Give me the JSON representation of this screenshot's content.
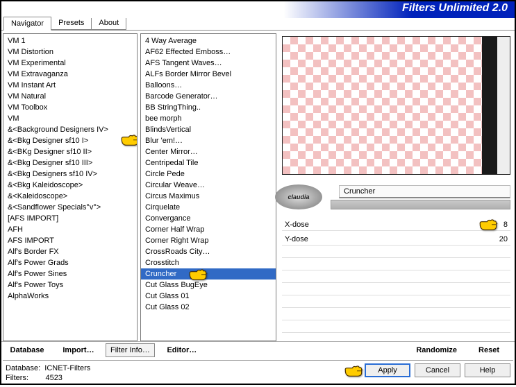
{
  "header": {
    "title": "Filters Unlimited 2.0"
  },
  "tabs": [
    {
      "label": "Navigator",
      "active": true
    },
    {
      "label": "Presets",
      "active": false
    },
    {
      "label": "About",
      "active": false
    }
  ],
  "categories": [
    "VM 1",
    "VM Distortion",
    "VM Experimental",
    "VM Extravaganza",
    "VM Instant Art",
    "VM Natural",
    "VM Toolbox",
    "VM",
    "&<Background Designers IV>",
    "&<Bkg Designer sf10 I>",
    "&<BKg Designer sf10 II>",
    "&<Bkg Designer sf10 III>",
    "&<Bkg Designers sf10 IV>",
    "&<Bkg Kaleidoscope>",
    "&<Kaleidoscope>",
    "&<Sandflower Specials°v°>",
    "[AFS IMPORT]",
    "AFH",
    "AFS IMPORT",
    "Alf's Border FX",
    "Alf's Power Grads",
    "Alf's Power Sines",
    "Alf's Power Toys",
    "AlphaWorks"
  ],
  "categories_pointer_index": 9,
  "filters": [
    "4 Way Average",
    "AF62 Effected Emboss…",
    "AFS Tangent Waves…",
    "ALFs Border Mirror Bevel",
    "Balloons…",
    "Barcode Generator…",
    "BB StringThing..",
    "bee morph",
    "BlindsVertical",
    "Blur 'em!…",
    "Center Mirror…",
    "Centripedal Tile",
    "Circle Pede",
    "Circular Weave…",
    "Circus Maximus",
    "Cirquelate",
    "Convergance",
    "Corner Half Wrap",
    "Corner Right Wrap",
    "CrossRoads City…",
    "Crosstitch",
    "Cruncher",
    "Cut Glass  BugEye",
    "Cut Glass 01",
    "Cut Glass 02"
  ],
  "filters_selected_index": 21,
  "preview_logo_text": "claudia",
  "current_filter": {
    "name": "Cruncher"
  },
  "params": [
    {
      "label": "X-dose",
      "value": 8,
      "pointer": true
    },
    {
      "label": "Y-dose",
      "value": 20,
      "pointer": false
    }
  ],
  "toolbar": {
    "database": "Database",
    "import": "Import…",
    "filter_info": "Filter Info…",
    "editor": "Editor…",
    "randomize": "Randomize",
    "reset": "Reset"
  },
  "status": {
    "db_label": "Database:",
    "db_value": "ICNET-Filters",
    "filters_label": "Filters:",
    "filters_value": "4523"
  },
  "dialog": {
    "apply": "Apply",
    "cancel": "Cancel",
    "help": "Help"
  }
}
